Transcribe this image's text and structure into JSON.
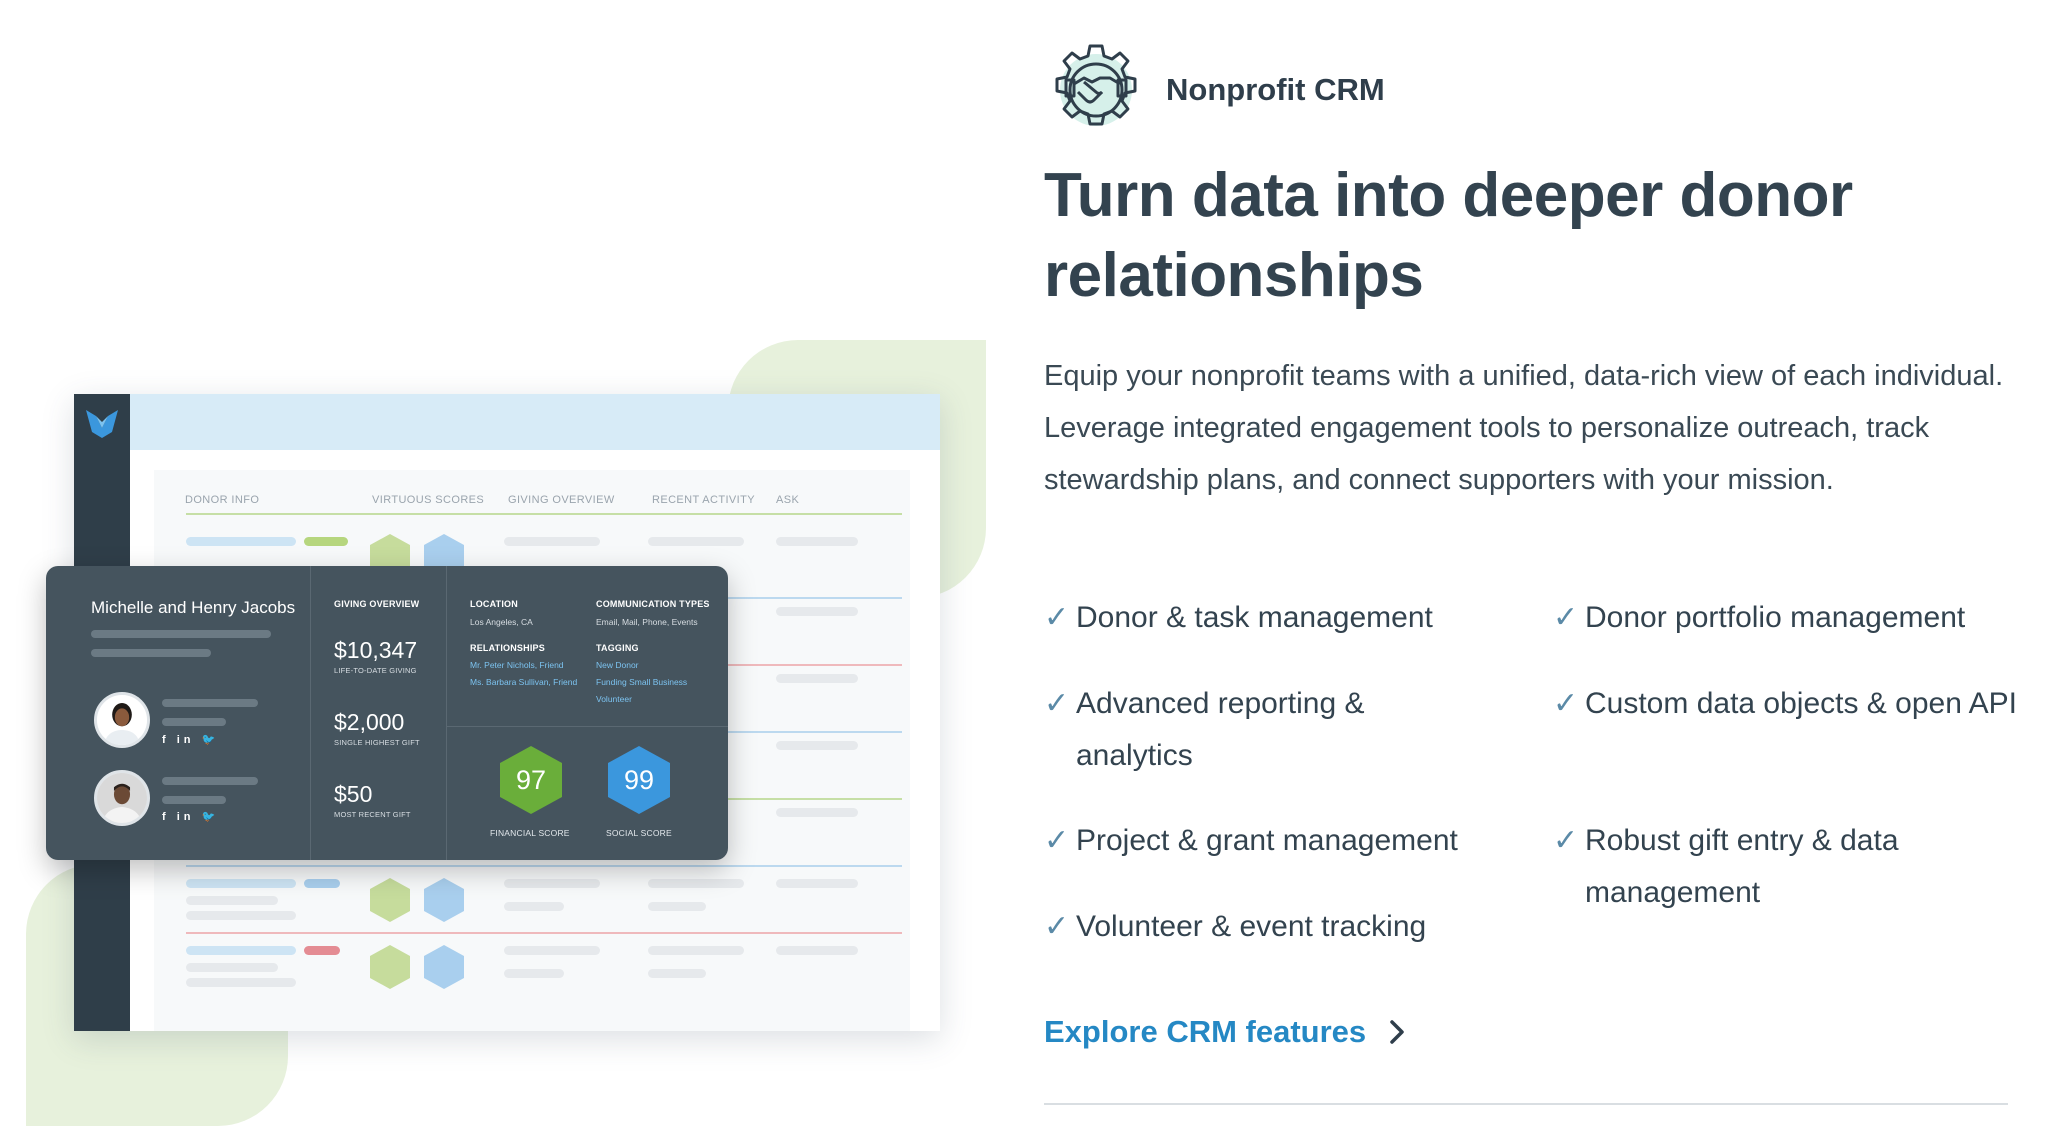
{
  "brand": {
    "name": "Nonprofit CRM",
    "icon": "gear-handshake-icon"
  },
  "headline": "Turn data into deeper donor relationships",
  "description": "Equip your nonprofit teams with a unified, data-rich view of each individual. Leverage integrated engagement tools to personalize outreach, track stewardship plans, and connect supporters with your mission.",
  "features": [
    "Donor & task management",
    "Donor portfolio management",
    "Advanced reporting & analytics",
    "Custom data objects & open API",
    "Project & grant management",
    "Robust gift entry & data management",
    "Volunteer & event tracking"
  ],
  "cta": {
    "label": "Explore CRM features",
    "icon": "chevron-right-icon"
  },
  "dashboard": {
    "columns": [
      "DONOR INFO",
      "VIRTUOUS SCORES",
      "GIVING OVERVIEW",
      "RECENT ACTIVITY",
      "ASK"
    ],
    "card": {
      "donor_name": "Michelle and Henry Jacobs",
      "social_icons": "f in 🐦",
      "giving_overview_label": "GIVING OVERVIEW",
      "amounts": [
        {
          "value": "$10,347",
          "label": "LIFE-TO-DATE GIVING"
        },
        {
          "value": "$2,000",
          "label": "SINGLE HIGHEST GIFT"
        },
        {
          "value": "$50",
          "label": "MOST RECENT GIFT"
        }
      ],
      "location_label": "LOCATION",
      "location_value": "Los Angeles, CA",
      "communication_label": "COMMUNICATION TYPES",
      "communication_value": "Email, Mail, Phone, Events",
      "relationships_label": "RELATIONSHIPS",
      "relationships": [
        "Mr. Peter Nichols, Friend",
        "Ms. Barbara Sullivan, Friend"
      ],
      "tagging_label": "TAGGING",
      "tags": [
        "New Donor",
        "Funding Small Business",
        "Volunteer"
      ],
      "scores": [
        {
          "value": "97",
          "label": "FINANCIAL SCORE",
          "color": "#6aae3a"
        },
        {
          "value": "99",
          "label": "SOCIAL SCORE",
          "color": "#3b97dd"
        }
      ]
    }
  },
  "colors": {
    "accent_blue": "#2588c4",
    "dark_slate": "#45545e",
    "leaf_green": "#e7f1dc",
    "check": "#5b8aa7"
  }
}
